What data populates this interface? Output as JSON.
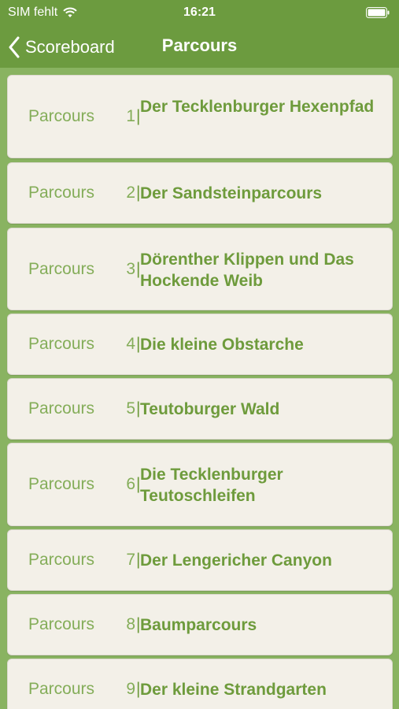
{
  "status_bar": {
    "carrier": "SIM fehlt",
    "time": "16:21"
  },
  "nav": {
    "back_label": "Scoreboard",
    "title": "Parcours"
  },
  "list": {
    "prefix": "Parcours",
    "items": [
      {
        "number": "1",
        "separator": "|",
        "title": "Der Tecklenburger Hexenpfad"
      },
      {
        "number": "2",
        "separator": "|",
        "title": "Der Sandsteinparcours"
      },
      {
        "number": "3",
        "separator": "|",
        "title": "Dörenther Klippen und Das Hockende Weib"
      },
      {
        "number": "4",
        "separator": "|",
        "title": "Die kleine Obstarche"
      },
      {
        "number": "5",
        "separator": "|",
        "title": "Teutoburger Wald"
      },
      {
        "number": "6",
        "separator": "|",
        "title": "Die Tecklenburger Teutoschleifen"
      },
      {
        "number": "7",
        "separator": "|",
        "title": "Der Lengericher Canyon"
      },
      {
        "number": "8",
        "separator": "|",
        "title": "Baumparcours"
      },
      {
        "number": "9",
        "separator": "|",
        "title": "Der kleine Strandgarten"
      }
    ]
  },
  "colors": {
    "nav_background": "#6c9b3f",
    "list_background": "#89b361",
    "row_background": "#f3f0e8",
    "prefix_color": "#84ad59",
    "title_color": "#6e9b3c"
  }
}
